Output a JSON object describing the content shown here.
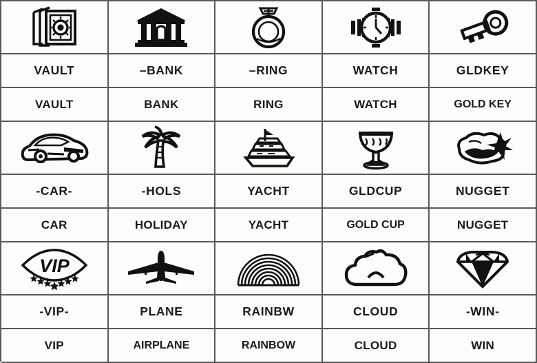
{
  "grid": {
    "columns": 5,
    "blocks": [
      {
        "icons": [
          {
            "icon": "vault-icon",
            "alt": "vault"
          },
          {
            "icon": "bank-icon",
            "alt": "bank"
          },
          {
            "icon": "ring-icon",
            "alt": "ring"
          },
          {
            "icon": "watch-icon",
            "alt": "watch"
          },
          {
            "icon": "key-icon",
            "alt": "gold key"
          }
        ],
        "short_labels": [
          "VAULT",
          "–BANK",
          "–RING",
          "WATCH",
          "GLDKEY"
        ],
        "long_labels": [
          "VAULT",
          "BANK",
          "RING",
          "WATCH",
          "GOLD KEY"
        ]
      },
      {
        "icons": [
          {
            "icon": "sportscar-icon",
            "alt": "car"
          },
          {
            "icon": "palmtree-icon",
            "alt": "holiday"
          },
          {
            "icon": "yacht-icon",
            "alt": "yacht"
          },
          {
            "icon": "goldcup-icon",
            "alt": "gold cup"
          },
          {
            "icon": "nugget-icon",
            "alt": "nugget"
          }
        ],
        "short_labels": [
          "-CAR-",
          "-HOLS",
          "YACHT",
          "GLDCUP",
          "NUGGET"
        ],
        "long_labels": [
          "CAR",
          "HOLIDAY",
          "YACHT",
          "GOLD CUP",
          "NUGGET"
        ]
      },
      {
        "icons": [
          {
            "icon": "vip-badge-icon",
            "alt": "VIP"
          },
          {
            "icon": "airplane-icon",
            "alt": "plane"
          },
          {
            "icon": "rainbow-icon",
            "alt": "rainbow"
          },
          {
            "icon": "cloud-icon",
            "alt": "cloud"
          },
          {
            "icon": "diamond-icon",
            "alt": "win"
          }
        ],
        "short_labels": [
          "-VIP-",
          "PLANE",
          "RAINBW",
          "CLOUD",
          "-WIN-"
        ],
        "long_labels": [
          "VIP",
          "AIRPLANE",
          "RAINBOW",
          "CLOUD",
          "WIN"
        ]
      }
    ]
  },
  "colors": {
    "ink": "#1a1a1a",
    "grid_line": "#5a5a5a",
    "cell_background": "#fdfdfc"
  },
  "vip_badge_text": "VIP"
}
